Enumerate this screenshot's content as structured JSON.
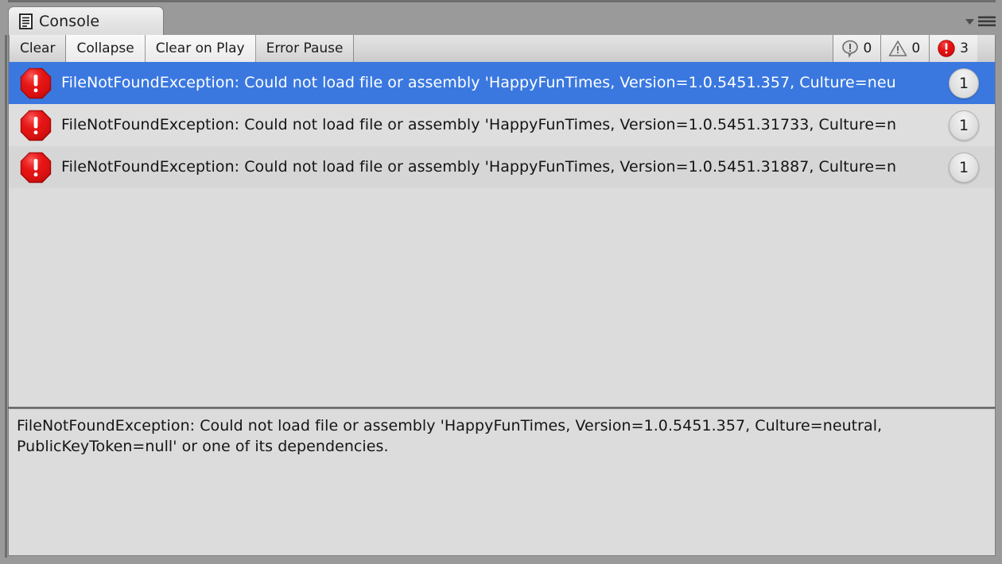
{
  "window": {
    "tab_label": "Console",
    "tab_icon": "console-document-icon",
    "menu_icon": "window-options-icon"
  },
  "toolbar": {
    "clear_label": "Clear",
    "collapse_label": "Collapse",
    "clear_on_play_label": "Clear on Play",
    "error_pause_label": "Error Pause",
    "counters": [
      {
        "icon": "info-icon",
        "name": "info-count",
        "value": "0"
      },
      {
        "icon": "warning-icon",
        "name": "warning-count",
        "value": "0"
      },
      {
        "icon": "error-icon",
        "name": "error-count",
        "value": "3"
      }
    ]
  },
  "log": {
    "entries": [
      {
        "icon": "error-icon",
        "selected": true,
        "text": "FileNotFoundException: Could not load file or assembly 'HappyFunTimes, Version=1.0.5451.357, Culture=neu",
        "count": "1"
      },
      {
        "icon": "error-icon",
        "selected": false,
        "text": "FileNotFoundException: Could not load file or assembly 'HappyFunTimes, Version=1.0.5451.31733, Culture=n",
        "count": "1"
      },
      {
        "icon": "error-icon",
        "selected": false,
        "text": "FileNotFoundException: Could not load file or assembly 'HappyFunTimes, Version=1.0.5451.31887, Culture=n",
        "count": "1"
      }
    ]
  },
  "detail": {
    "text": "FileNotFoundException: Could not load file or assembly 'HappyFunTimes, Version=1.0.5451.357, Culture=neutral, PublicKeyToken=null' or one of its dependencies."
  },
  "colors": {
    "selection": "#3a78e0",
    "error_red": "#e01010",
    "panel_bg": "#dcdcdc",
    "chrome_bg": "#9a9a9a"
  }
}
